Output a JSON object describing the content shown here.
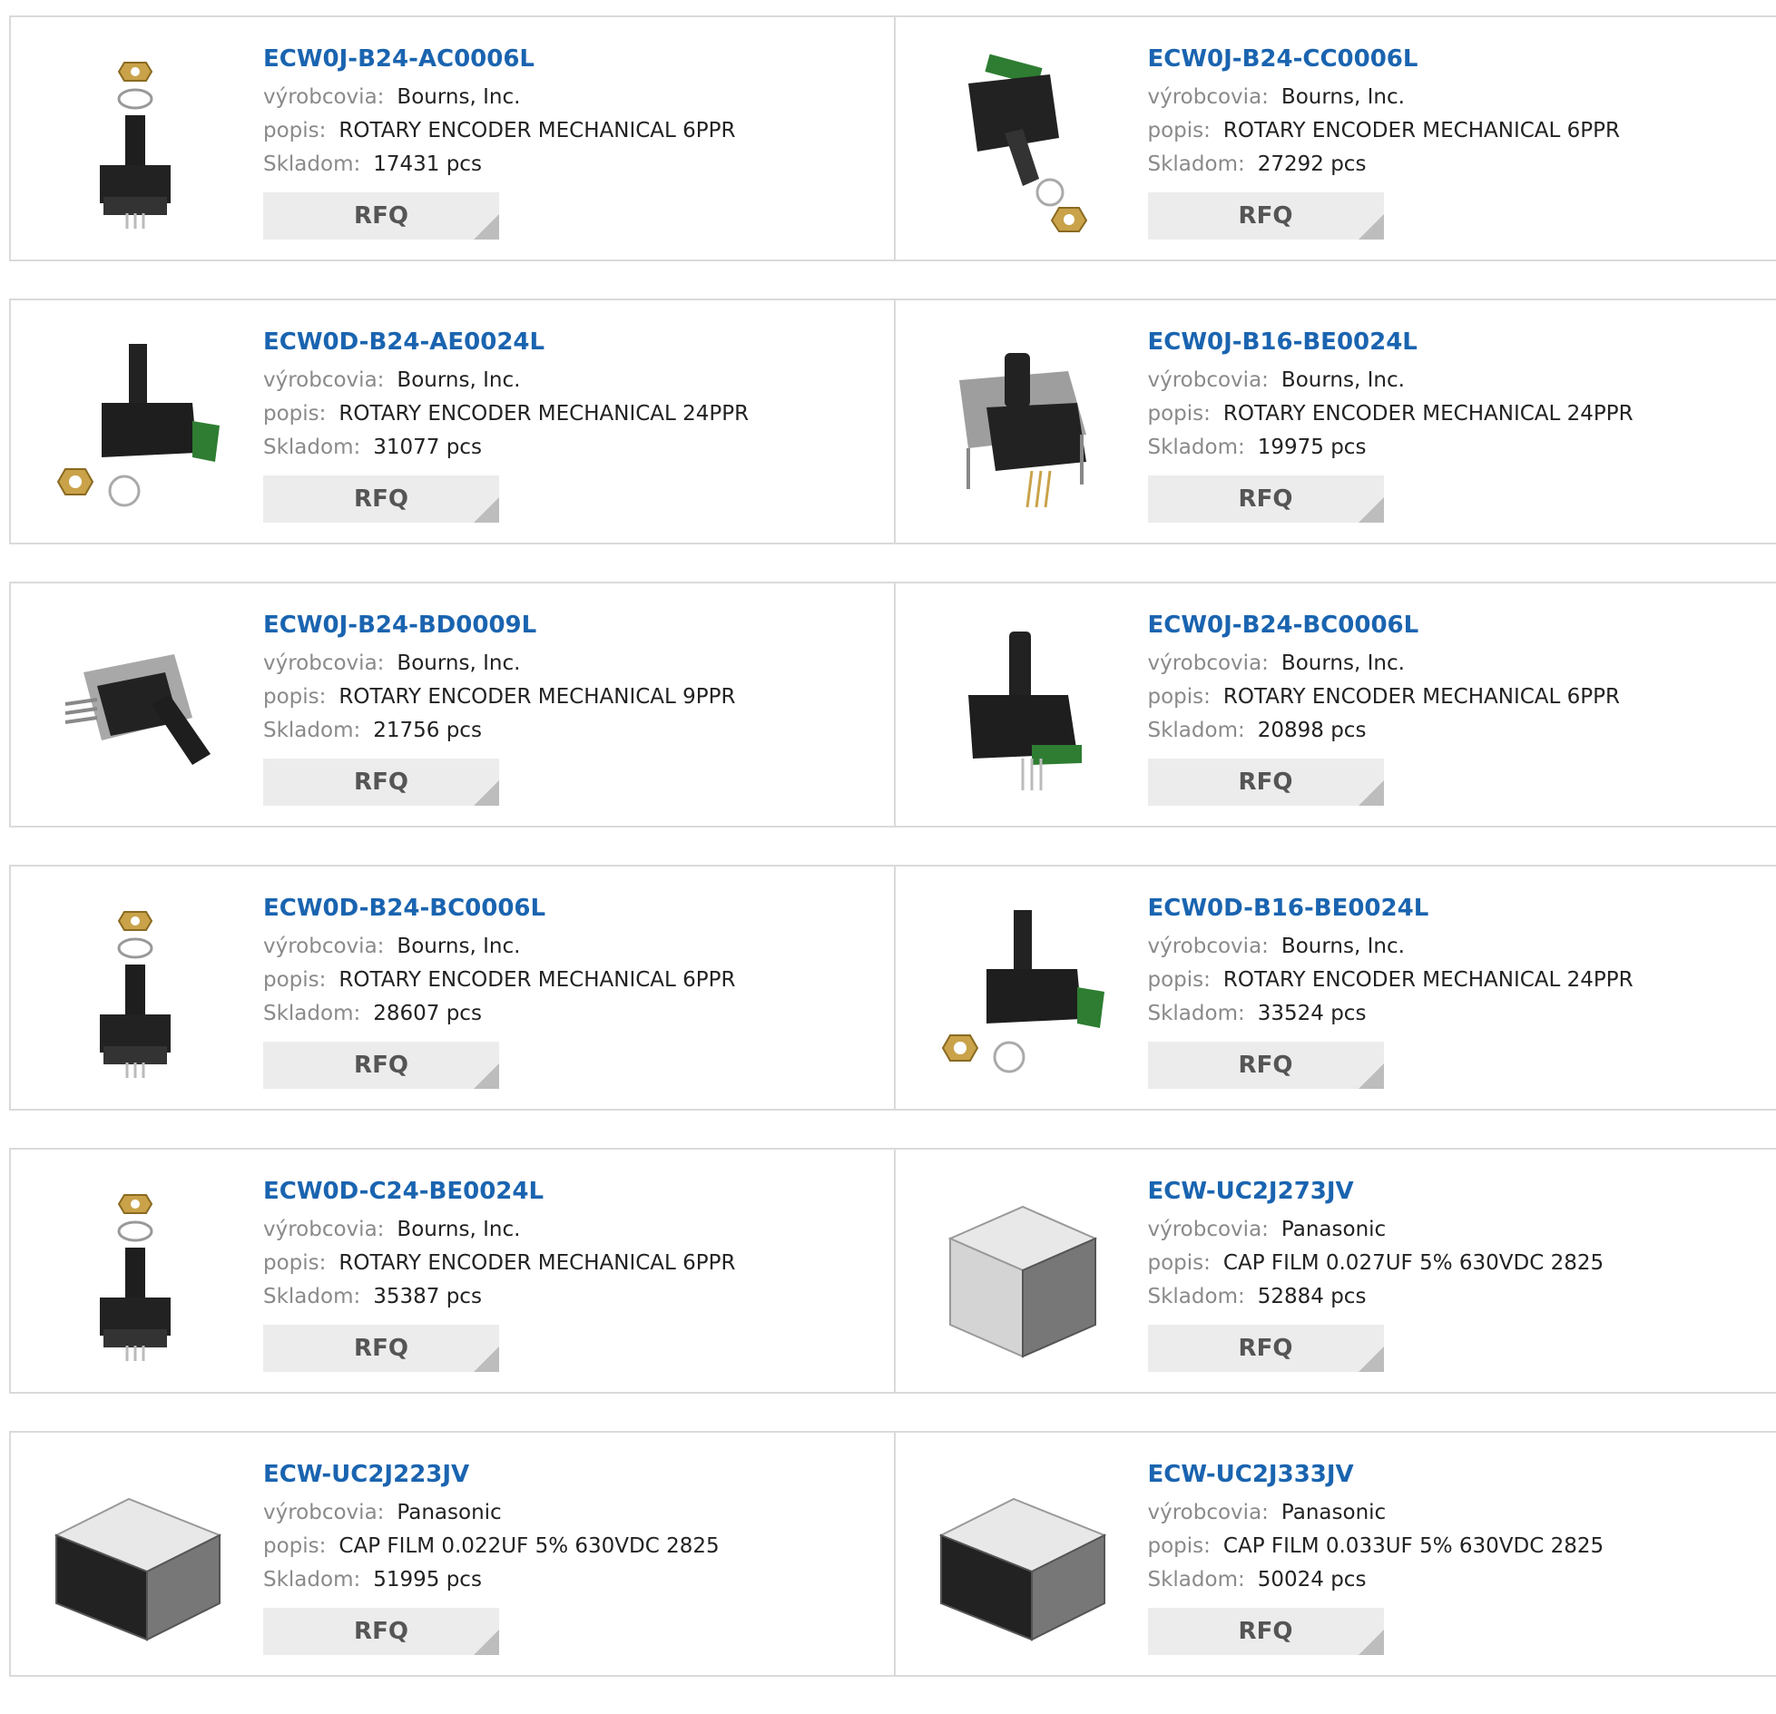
{
  "labels": {
    "manufacturer": "výrobcovia:",
    "description": "popis:",
    "stock": "Skladom:",
    "rfq": "RFQ"
  },
  "colors": {
    "link": "#1a64b0",
    "border": "#dadada",
    "button": "#ececec"
  },
  "products": [
    {
      "part": "ECW0J-B24-AC0006L",
      "manufacturer": "Bourns, Inc.",
      "description": "ROTARY ENCODER MECHANICAL 6PPR",
      "stock": "17431 pcs",
      "image": "encoder-vertical-icon"
    },
    {
      "part": "ECW0J-B24-CC0006L",
      "manufacturer": "Bourns, Inc.",
      "description": "ROTARY ENCODER MECHANICAL 6PPR",
      "stock": "27292 pcs",
      "image": "encoder-angled-icon"
    },
    {
      "part": "ECW0D-B24-AE0024L",
      "manufacturer": "Bourns, Inc.",
      "description": "ROTARY ENCODER MECHANICAL 24PPR",
      "stock": "31077 pcs",
      "image": "encoder-pcb-icon"
    },
    {
      "part": "ECW0J-B16-BE0024L",
      "manufacturer": "Bourns, Inc.",
      "description": "ROTARY ENCODER MECHANICAL 24PPR",
      "stock": "19975 pcs",
      "image": "encoder-bracket-icon"
    },
    {
      "part": "ECW0J-B24-BD0009L",
      "manufacturer": "Bourns, Inc.",
      "description": "ROTARY ENCODER MECHANICAL 9PPR",
      "stock": "21756 pcs",
      "image": "encoder-side-icon"
    },
    {
      "part": "ECW0J-B24-BC0006L",
      "manufacturer": "Bourns, Inc.",
      "description": "ROTARY ENCODER MECHANICAL 6PPR",
      "stock": "20898 pcs",
      "image": "encoder-plain-icon"
    },
    {
      "part": "ECW0D-B24-BC0006L",
      "manufacturer": "Bourns, Inc.",
      "description": "ROTARY ENCODER MECHANICAL 6PPR",
      "stock": "28607 pcs",
      "image": "encoder-vertical-icon"
    },
    {
      "part": "ECW0D-B16-BE0024L",
      "manufacturer": "Bourns, Inc.",
      "description": "ROTARY ENCODER MECHANICAL 24PPR",
      "stock": "33524 pcs",
      "image": "encoder-pcb-icon"
    },
    {
      "part": "ECW0D-C24-BE0024L",
      "manufacturer": "Bourns, Inc.",
      "description": "ROTARY ENCODER MECHANICAL 6PPR",
      "stock": "35387 pcs",
      "image": "encoder-vertical-icon"
    },
    {
      "part": "ECW-UC2J273JV",
      "manufacturer": "Panasonic",
      "description": "CAP FILM 0.027UF 5% 630VDC 2825",
      "stock": "52884 pcs",
      "image": "film-capacitor-icon"
    },
    {
      "part": "ECW-UC2J223JV",
      "manufacturer": "Panasonic",
      "description": "CAP FILM 0.022UF 5% 630VDC 2825",
      "stock": "51995 pcs",
      "image": "film-capacitor-icon"
    },
    {
      "part": "ECW-UC2J333JV",
      "manufacturer": "Panasonic",
      "description": "CAP FILM 0.033UF 5% 630VDC 2825",
      "stock": "50024 pcs",
      "image": "film-capacitor-icon"
    }
  ]
}
